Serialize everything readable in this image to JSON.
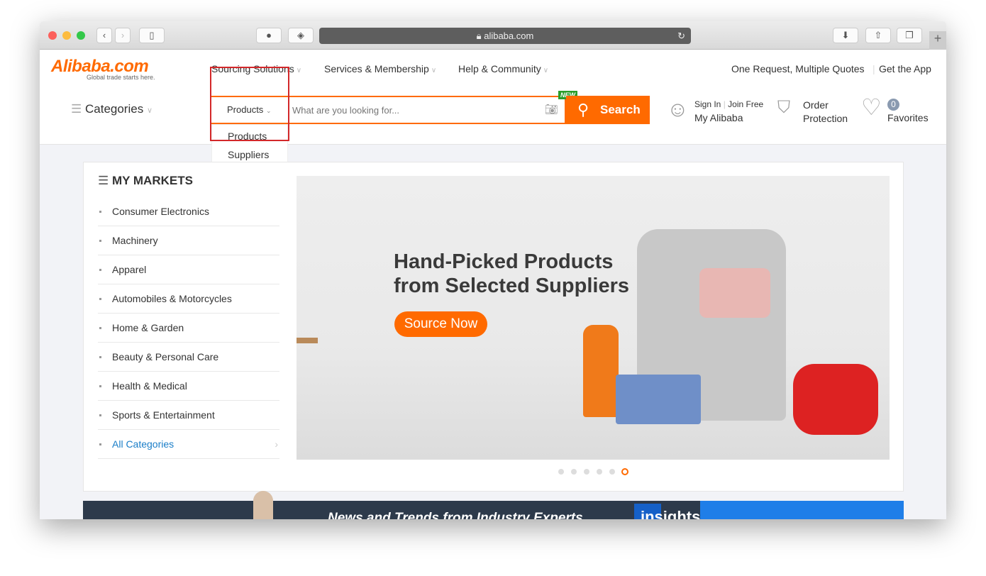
{
  "browser": {
    "url": "alibaba.com"
  },
  "logo": {
    "name": "Alibaba.com",
    "tagline": "Global trade starts here."
  },
  "top_nav": [
    {
      "label": "Sourcing Solutions"
    },
    {
      "label": "Services & Membership"
    },
    {
      "label": "Help & Community"
    }
  ],
  "top_links": {
    "quotes": "One Request, Multiple Quotes",
    "app": "Get the App"
  },
  "categories_label": "Categories",
  "search": {
    "type_selected": "Products",
    "placeholder": "What are you looking for...",
    "button": "Search",
    "badge": "NEW",
    "dropdown": [
      "Products",
      "Suppliers"
    ]
  },
  "account": {
    "sign_in": "Sign In",
    "join": "Join Free",
    "my": "My Alibaba"
  },
  "order": {
    "line1": "Order",
    "line2": "Protection"
  },
  "favorites": {
    "count": "0",
    "label": "Favorites"
  },
  "markets": {
    "title": "MY MARKETS",
    "items": [
      "Consumer Electronics",
      "Machinery",
      "Apparel",
      "Automobiles & Motorcycles",
      "Home & Garden",
      "Beauty & Personal Care",
      "Health & Medical",
      "Sports & Entertainment"
    ],
    "all": "All Categories"
  },
  "hero": {
    "line1": "Hand-Picked Products",
    "line2": "from Selected Suppliers",
    "cta": "Source Now",
    "slides": 6,
    "active_slide": 6
  },
  "news_banner": {
    "text": "News and Trends from Industry Experts",
    "brand": "insights"
  },
  "colors": {
    "brand": "#ff6a00",
    "highlight": "#d3282a",
    "link": "#1a7ec8"
  }
}
